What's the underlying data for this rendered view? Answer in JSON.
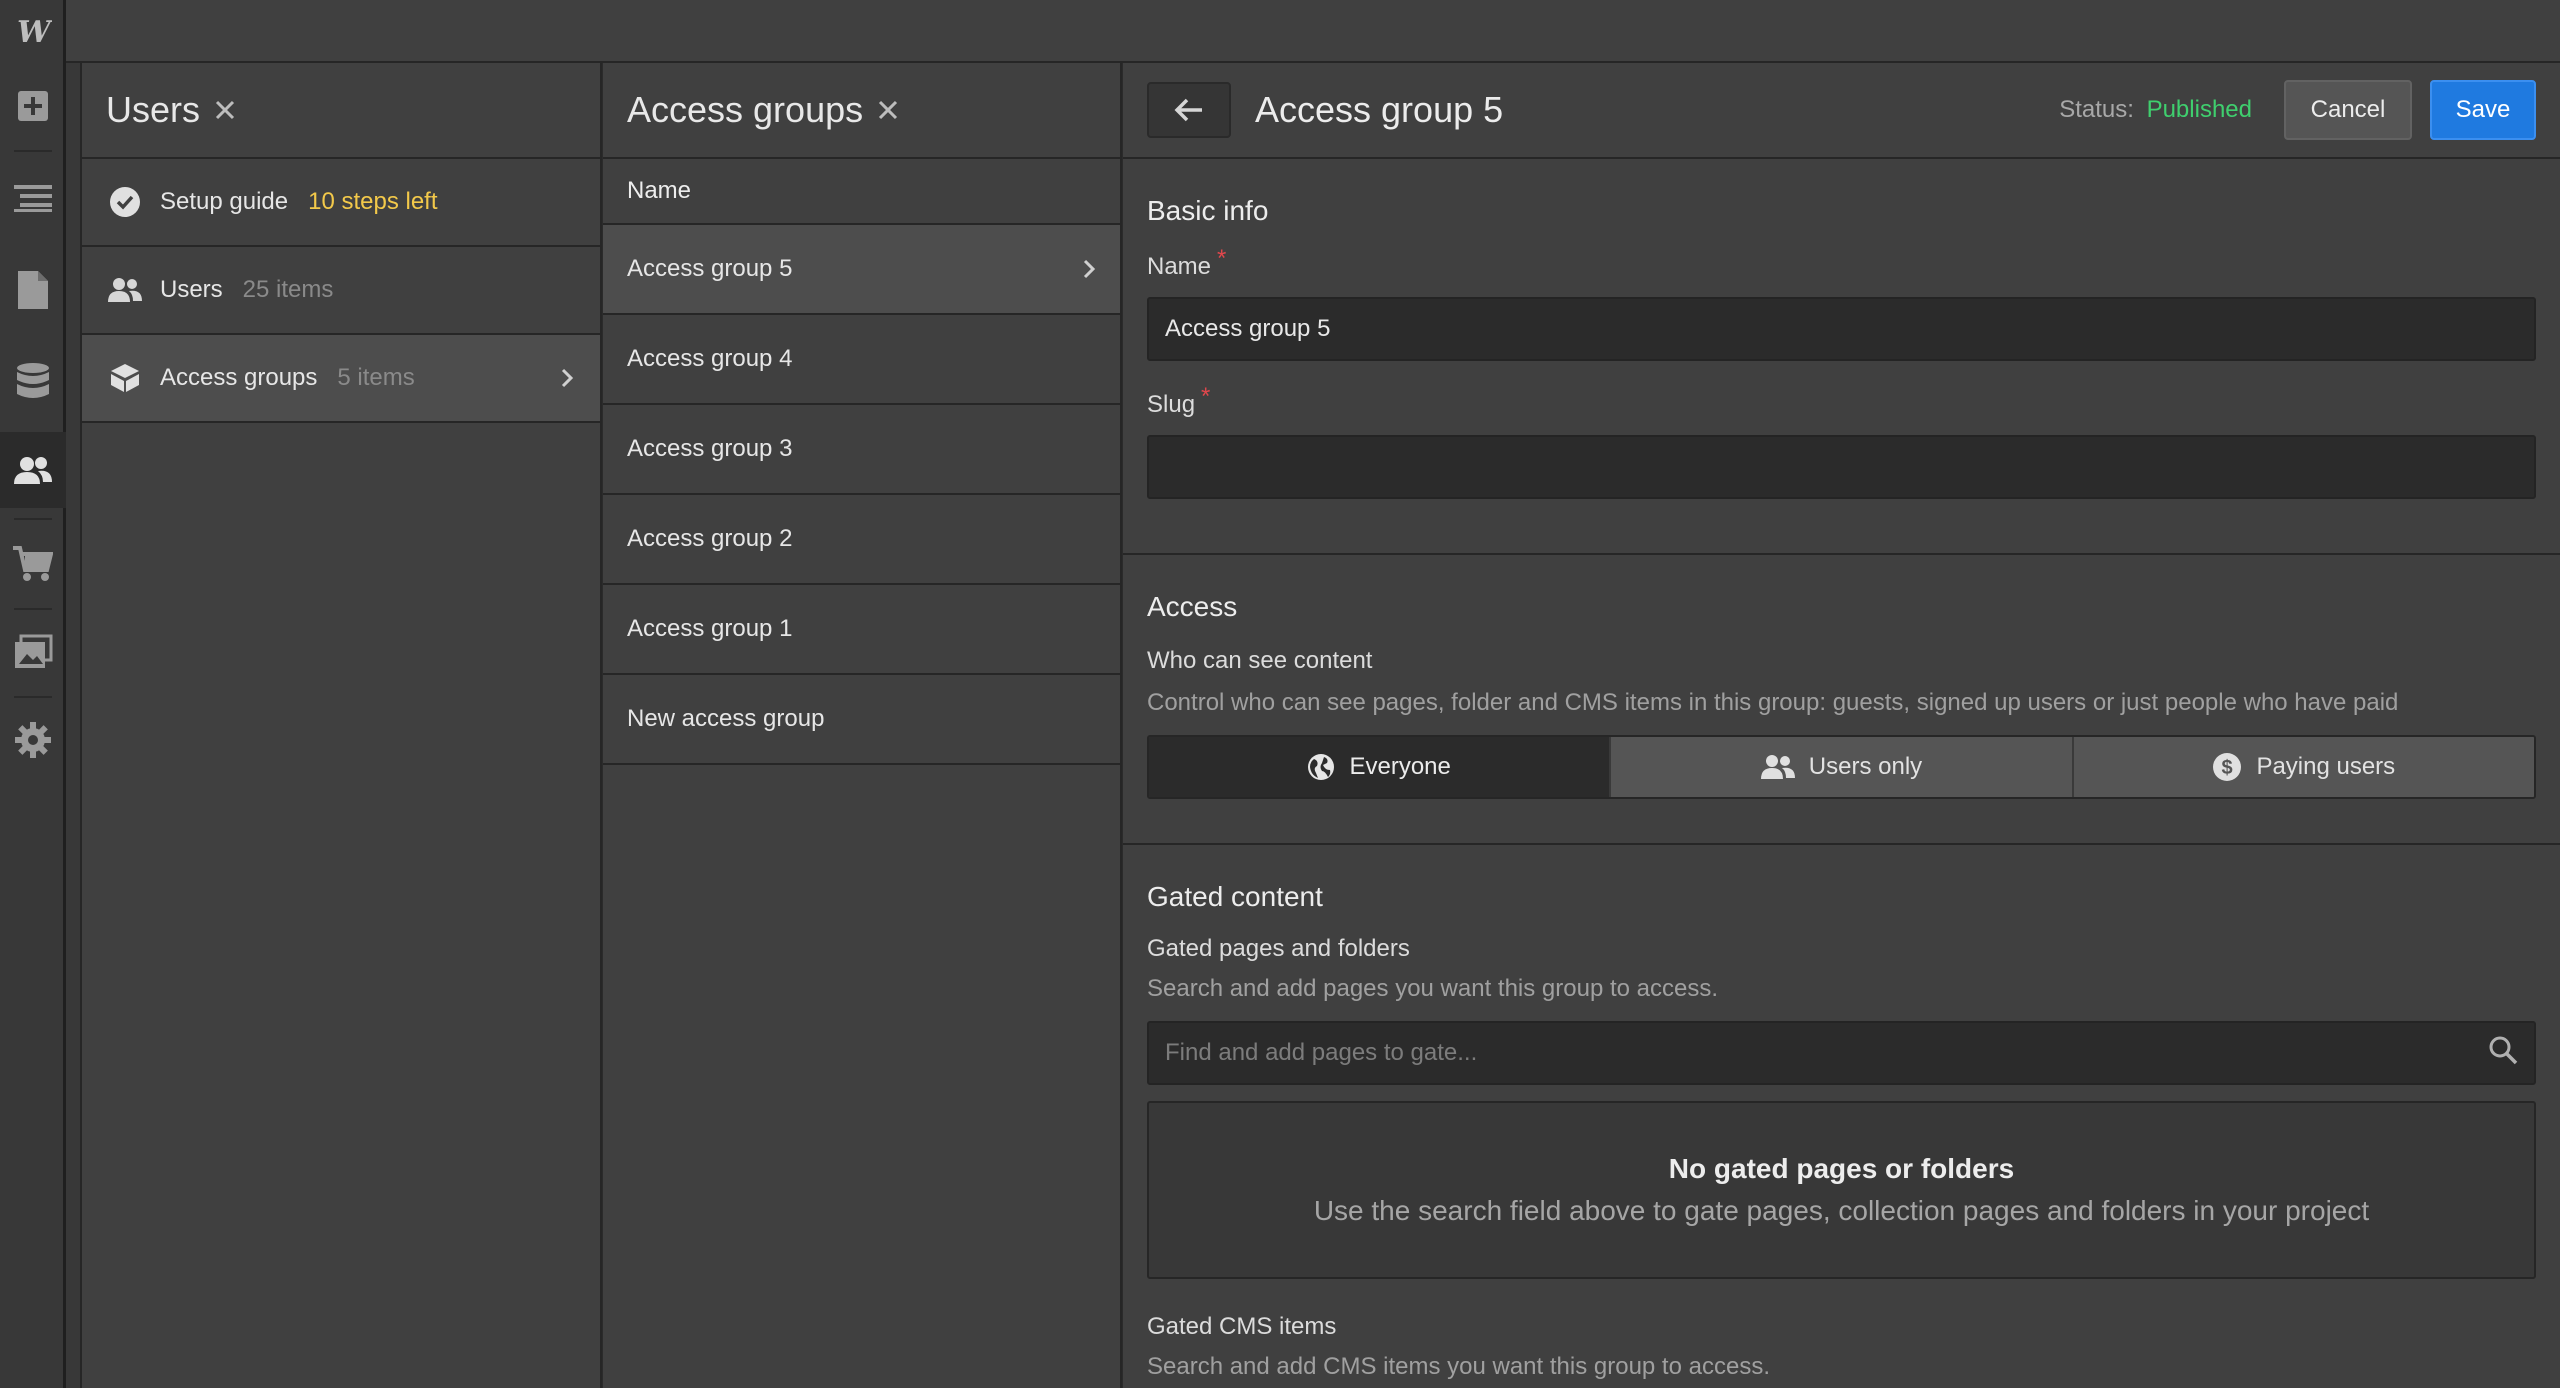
{
  "rail": {
    "logo": "W",
    "icons": [
      "add-icon",
      "navigator-icon",
      "pages-icon",
      "cms-icon",
      "users-icon",
      "ecommerce-icon",
      "assets-icon",
      "settings-icon"
    ]
  },
  "users_panel": {
    "title": "Users",
    "items": [
      {
        "label": "Setup guide",
        "meta": "10 steps left",
        "icon": "check-circle-icon"
      },
      {
        "label": "Users",
        "meta": "25 items",
        "icon": "users-icon"
      },
      {
        "label": "Access groups",
        "meta": "5 items",
        "icon": "box-icon"
      }
    ]
  },
  "groups_panel": {
    "title": "Access groups",
    "column_header": "Name",
    "rows": [
      "Access group 5",
      "Access group 4",
      "Access group 3",
      "Access group 2",
      "Access group 1",
      "New access group"
    ]
  },
  "detail": {
    "title": "Access group 5",
    "status_label": "Status:",
    "status_value": "Published",
    "cancel_label": "Cancel",
    "save_label": "Save",
    "basic_info": {
      "heading": "Basic info",
      "name_label": "Name",
      "name_value": "Access group 5",
      "slug_label": "Slug",
      "slug_value": "",
      "required_mark": "*"
    },
    "access": {
      "heading": "Access",
      "label": "Who can see content",
      "help": "Control who can see pages, folder and CMS items in this group: guests, signed up users or just people who have paid",
      "options": [
        "Everyone",
        "Users only",
        "Paying users"
      ],
      "selected": "Everyone"
    },
    "gated": {
      "heading": "Gated content",
      "pages_label": "Gated pages and folders",
      "pages_help": "Search and add pages you want this group to access.",
      "search_placeholder": "Find and add pages to gate...",
      "empty_title": "No gated pages or folders",
      "empty_text": "Use the search field above to gate pages, collection pages and folders in your project",
      "cms_label": "Gated CMS items",
      "cms_help": "Search and add CMS items you want this group to access."
    }
  },
  "colors": {
    "accent": "#1f7ae0",
    "published": "#3fcf6e",
    "warning": "#f3c94a",
    "required": "#e0474c"
  }
}
